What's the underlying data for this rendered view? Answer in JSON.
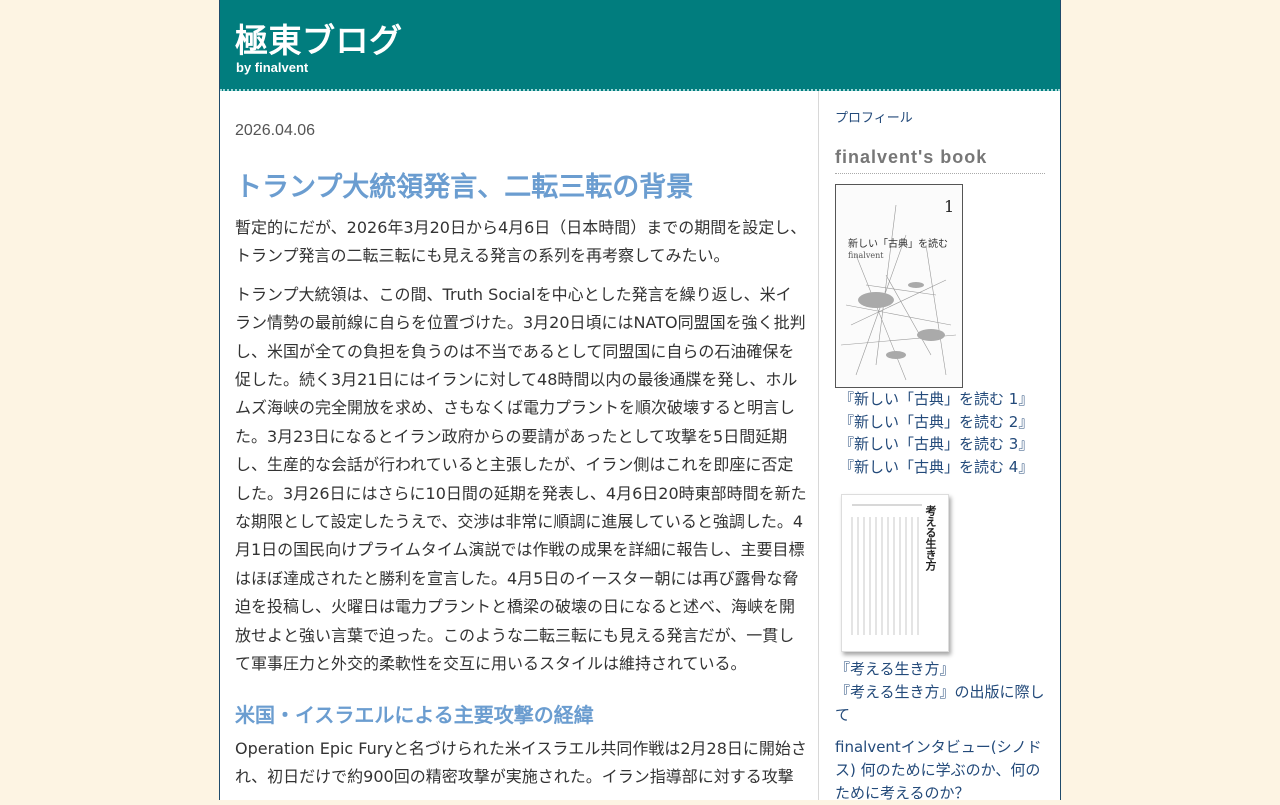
{
  "header": {
    "site_title": "極東ブログ",
    "subtitle": "by finalvent"
  },
  "post": {
    "date": "2026.04.06",
    "title": "トランプ大統領発言、二転三転の背景",
    "paragraphs": [
      "暫定的にだが、2026年3月20日から4月6日（日本時間）までの期間を設定し、トランプ発言の二転三転にも見える発言の系列を再考察してみたい。",
      "トランプ大統領は、この間、Truth Socialを中心とした発言を繰り返し、米イラン情勢の最前線に自らを位置づけた。3月20日頃にはNATO同盟国を強く批判し、米国が全ての負担を負うのは不当であるとして同盟国に自らの石油確保を促した。続く3月21日にはイランに対して48時間以内の最後通牒を発し、ホルムズ海峡の完全開放を求め、さもなくば電力プラントを順次破壊すると明言した。3月23日になるとイラン政府からの要請があったとして攻撃を5日間延期し、生産的な会話が行われていると主張したが、イラン側はこれを即座に否定した。3月26日にはさらに10日間の延期を発表し、4月6日20時東部時間を新たな期限として設定したうえで、交渉は非常に順調に進展していると強調した。4月1日の国民向けプライムタイム演説では作戦の成果を詳細に報告し、主要目標はほぼ達成されたと勝利を宣言した。4月5日のイースター朝には再び露骨な脅迫を投稿し、火曜日は電力プラントと橋梁の破壊の日になると述べ、海峡を開放せよと強い言葉で迫った。このような二転三転にも見える発言だが、一貫して軍事圧力と外交的柔軟性を交互に用いるスタイルは維持されている。"
    ],
    "section_heading": "米国・イスラエルによる主要攻撃の経緯",
    "section_paragraph": "Operation Epic Furyと名づけられた米イスラエル共同作戦は2月28日に開始され、初日だけで約900回の精密攻撃が実施された。イラン指導部に対する攻撃"
  },
  "sidebar": {
    "profile_label": "プロフィール",
    "book_heading": "finalvent's book",
    "cover1": {
      "number": "1",
      "title": "新しい「古典」を読む",
      "author": "finalvent"
    },
    "book_links": [
      "『新しい「古典」を読む 1』",
      "『新しい「古典」を読む 2』",
      "『新しい「古典」を読む 3』",
      "『新しい「古典」を読む 4』"
    ],
    "cover2": {
      "title": "考える生き方"
    },
    "links2": [
      "『考える生き方』",
      "『考える生き方』の出版に際して"
    ],
    "interview": "finalventインタビュー(シノドス) 何のために学ぶのか、何のために考えるのか？"
  }
}
